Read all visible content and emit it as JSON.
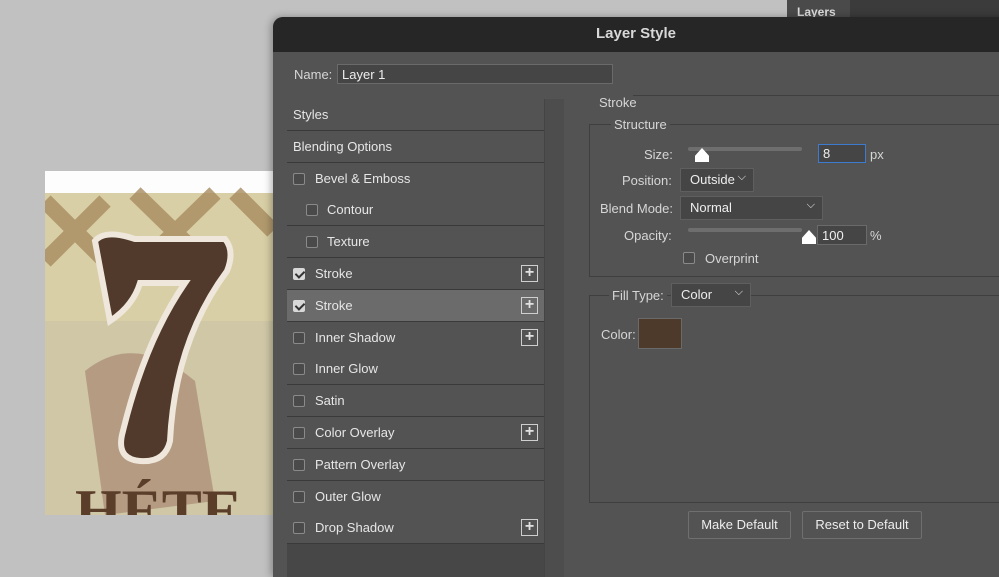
{
  "panel": {
    "layers_tab": "Layers"
  },
  "dialog": {
    "title": "Layer Style",
    "name_label": "Name:",
    "name_value": "Layer 1",
    "styles_list": [
      {
        "label": "Styles",
        "checkbox": false
      },
      {
        "label": "Blending Options",
        "checkbox": false
      },
      {
        "label": "Bevel & Emboss",
        "checkbox": true,
        "checked": false
      },
      {
        "label": "Contour",
        "checkbox": true,
        "checked": false,
        "indent": true
      },
      {
        "label": "Texture",
        "checkbox": true,
        "checked": false,
        "indent": true
      },
      {
        "label": "Stroke",
        "checkbox": true,
        "checked": true,
        "plus": true
      },
      {
        "label": "Stroke",
        "checkbox": true,
        "checked": true,
        "plus": true,
        "selected": true
      },
      {
        "label": "Inner Shadow",
        "checkbox": true,
        "checked": false,
        "plus": true
      },
      {
        "label": "Inner Glow",
        "checkbox": true,
        "checked": false
      },
      {
        "label": "Satin",
        "checkbox": true,
        "checked": false
      },
      {
        "label": "Color Overlay",
        "checkbox": true,
        "checked": false,
        "plus": true
      },
      {
        "label": "Pattern Overlay",
        "checkbox": true,
        "checked": false
      },
      {
        "label": "Outer Glow",
        "checkbox": true,
        "checked": false
      },
      {
        "label": "Drop Shadow",
        "checkbox": true,
        "checked": false,
        "plus": true
      }
    ],
    "stroke": {
      "section": "Stroke",
      "structure": "Structure",
      "size_label": "Size:",
      "size_value": "8",
      "size_unit": "px",
      "size_fraction": 0.03,
      "position_label": "Position:",
      "position_value": "Outside",
      "blend_label": "Blend Mode:",
      "blend_value": "Normal",
      "opacity_label": "Opacity:",
      "opacity_value": "100",
      "opacity_unit": "%",
      "opacity_percent": 100,
      "overprint_label": "Overprint",
      "overprint_checked": false,
      "fill_type_label": "Fill Type:",
      "fill_type_value": "Color",
      "color_label": "Color:",
      "color_hex": "#4e3a2a"
    },
    "make_default": "Make Default",
    "reset_default": "Reset to Default"
  }
}
